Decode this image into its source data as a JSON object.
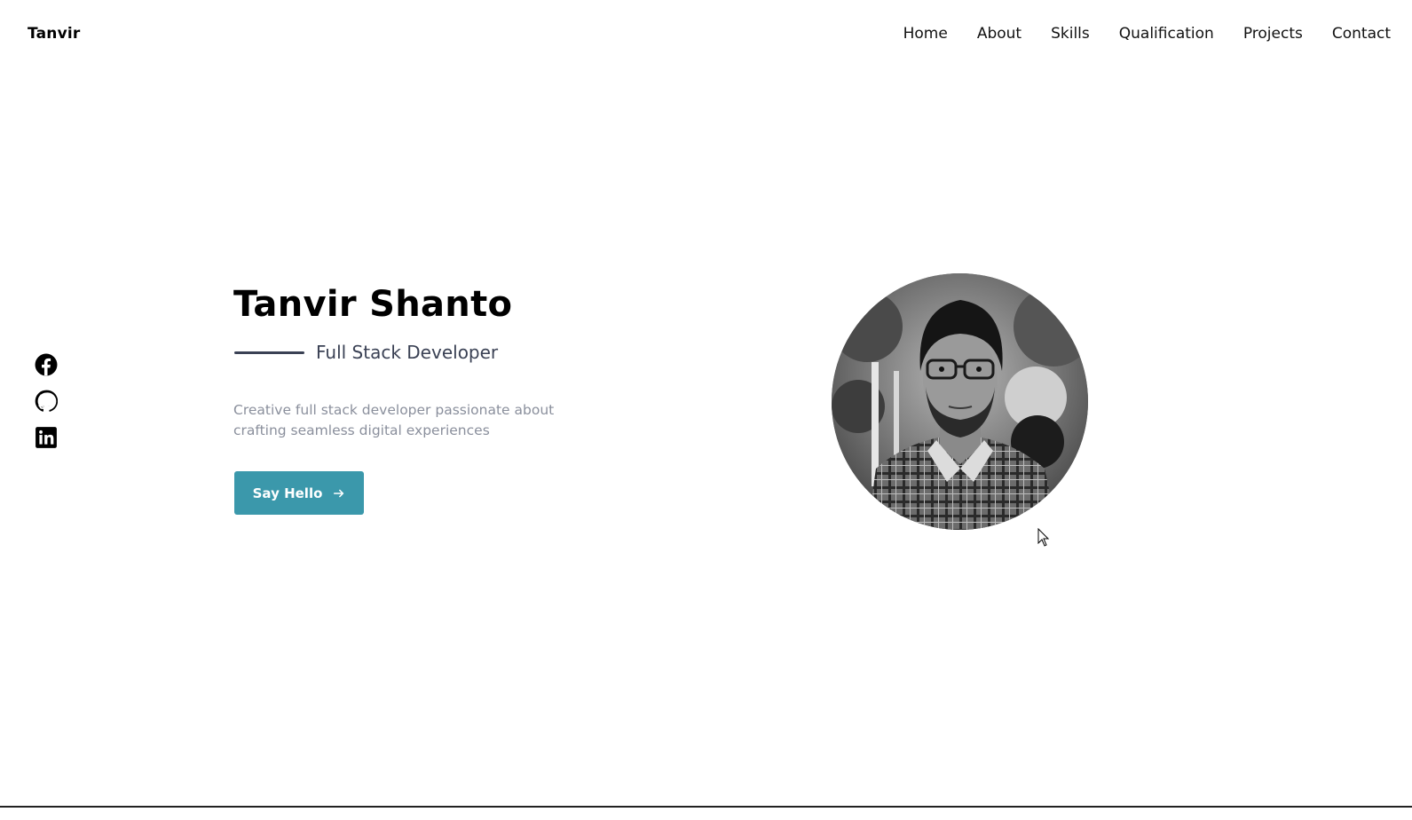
{
  "header": {
    "logo": "Tanvir",
    "nav": [
      {
        "label": "Home"
      },
      {
        "label": "About"
      },
      {
        "label": "Skills"
      },
      {
        "label": "Qualification"
      },
      {
        "label": "Projects"
      },
      {
        "label": "Contact"
      }
    ]
  },
  "social": [
    {
      "icon": "facebook-icon"
    },
    {
      "icon": "github-icon"
    },
    {
      "icon": "linkedin-icon"
    }
  ],
  "hero": {
    "name": "Tanvir Shanto",
    "subtitle": "Full Stack Developer",
    "description": "Creative full stack developer passionate about crafting seamless digital experiences",
    "cta_label": "Say Hello",
    "cta_icon": "arrow-right-icon",
    "avatar_icon": "profile-photo"
  },
  "colors": {
    "accent": "#3b98ab",
    "subtitle": "#3a4154",
    "description": "#8a8f9c",
    "text": "#000000"
  }
}
